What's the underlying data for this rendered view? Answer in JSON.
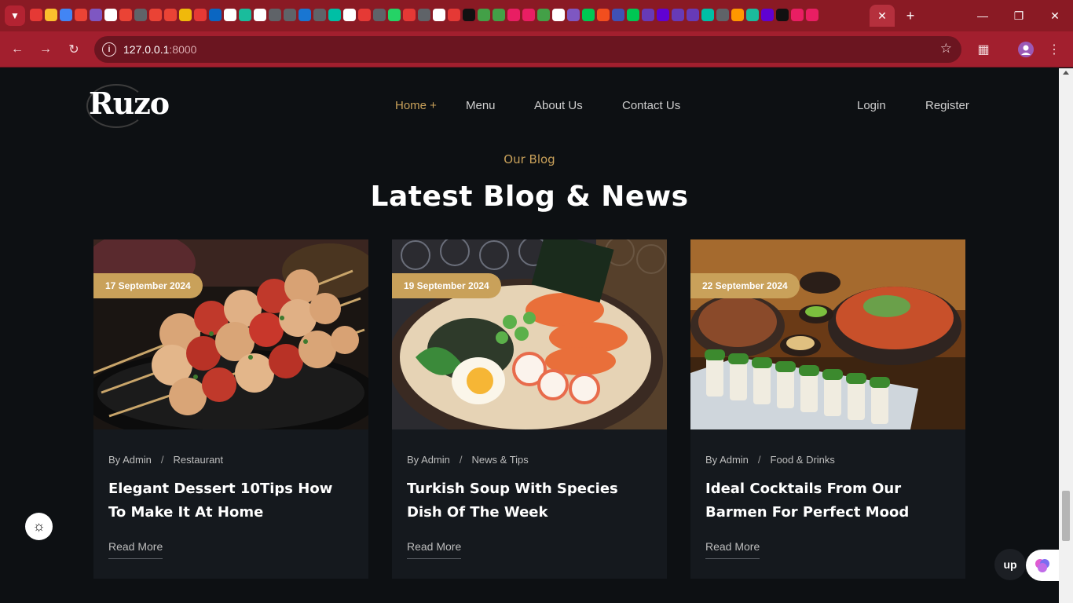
{
  "browser": {
    "url_host": "127.0.0.1",
    "url_port": ":8000",
    "colors": {
      "frame": "#8a1a24",
      "toolbar": "#a21f2e",
      "omnibox": "#6b1520"
    }
  },
  "header": {
    "logo": "Ruzo",
    "nav": [
      {
        "label": "Home +",
        "active": true
      },
      {
        "label": "Menu"
      },
      {
        "label": "About Us"
      },
      {
        "label": "Contact Us"
      }
    ],
    "auth": {
      "login": "Login",
      "register": "Register"
    }
  },
  "section": {
    "subtitle": "Our Blog",
    "title": "Latest Blog & News"
  },
  "posts": [
    {
      "date": "17 September 2024",
      "author": "By Admin",
      "category": "Restaurant",
      "title": "Elegant Dessert 10Tips How To Make It At Home",
      "cta": "Read More",
      "image": "chicken-skewers"
    },
    {
      "date": "19 September 2024",
      "author": "By Admin",
      "category": "News & Tips",
      "title": "Turkish Soup With Species Dish Of The Week",
      "cta": "Read More",
      "image": "ramen-bowl"
    },
    {
      "date": "22 September 2024",
      "author": "By Admin",
      "category": "Food & Drinks",
      "title": "Ideal Cocktails From Our Barmen For Perfect Mood",
      "cta": "Read More",
      "image": "sushi-platter"
    }
  ],
  "floating": {
    "up_label": "up"
  },
  "accent": "#c9a15a"
}
